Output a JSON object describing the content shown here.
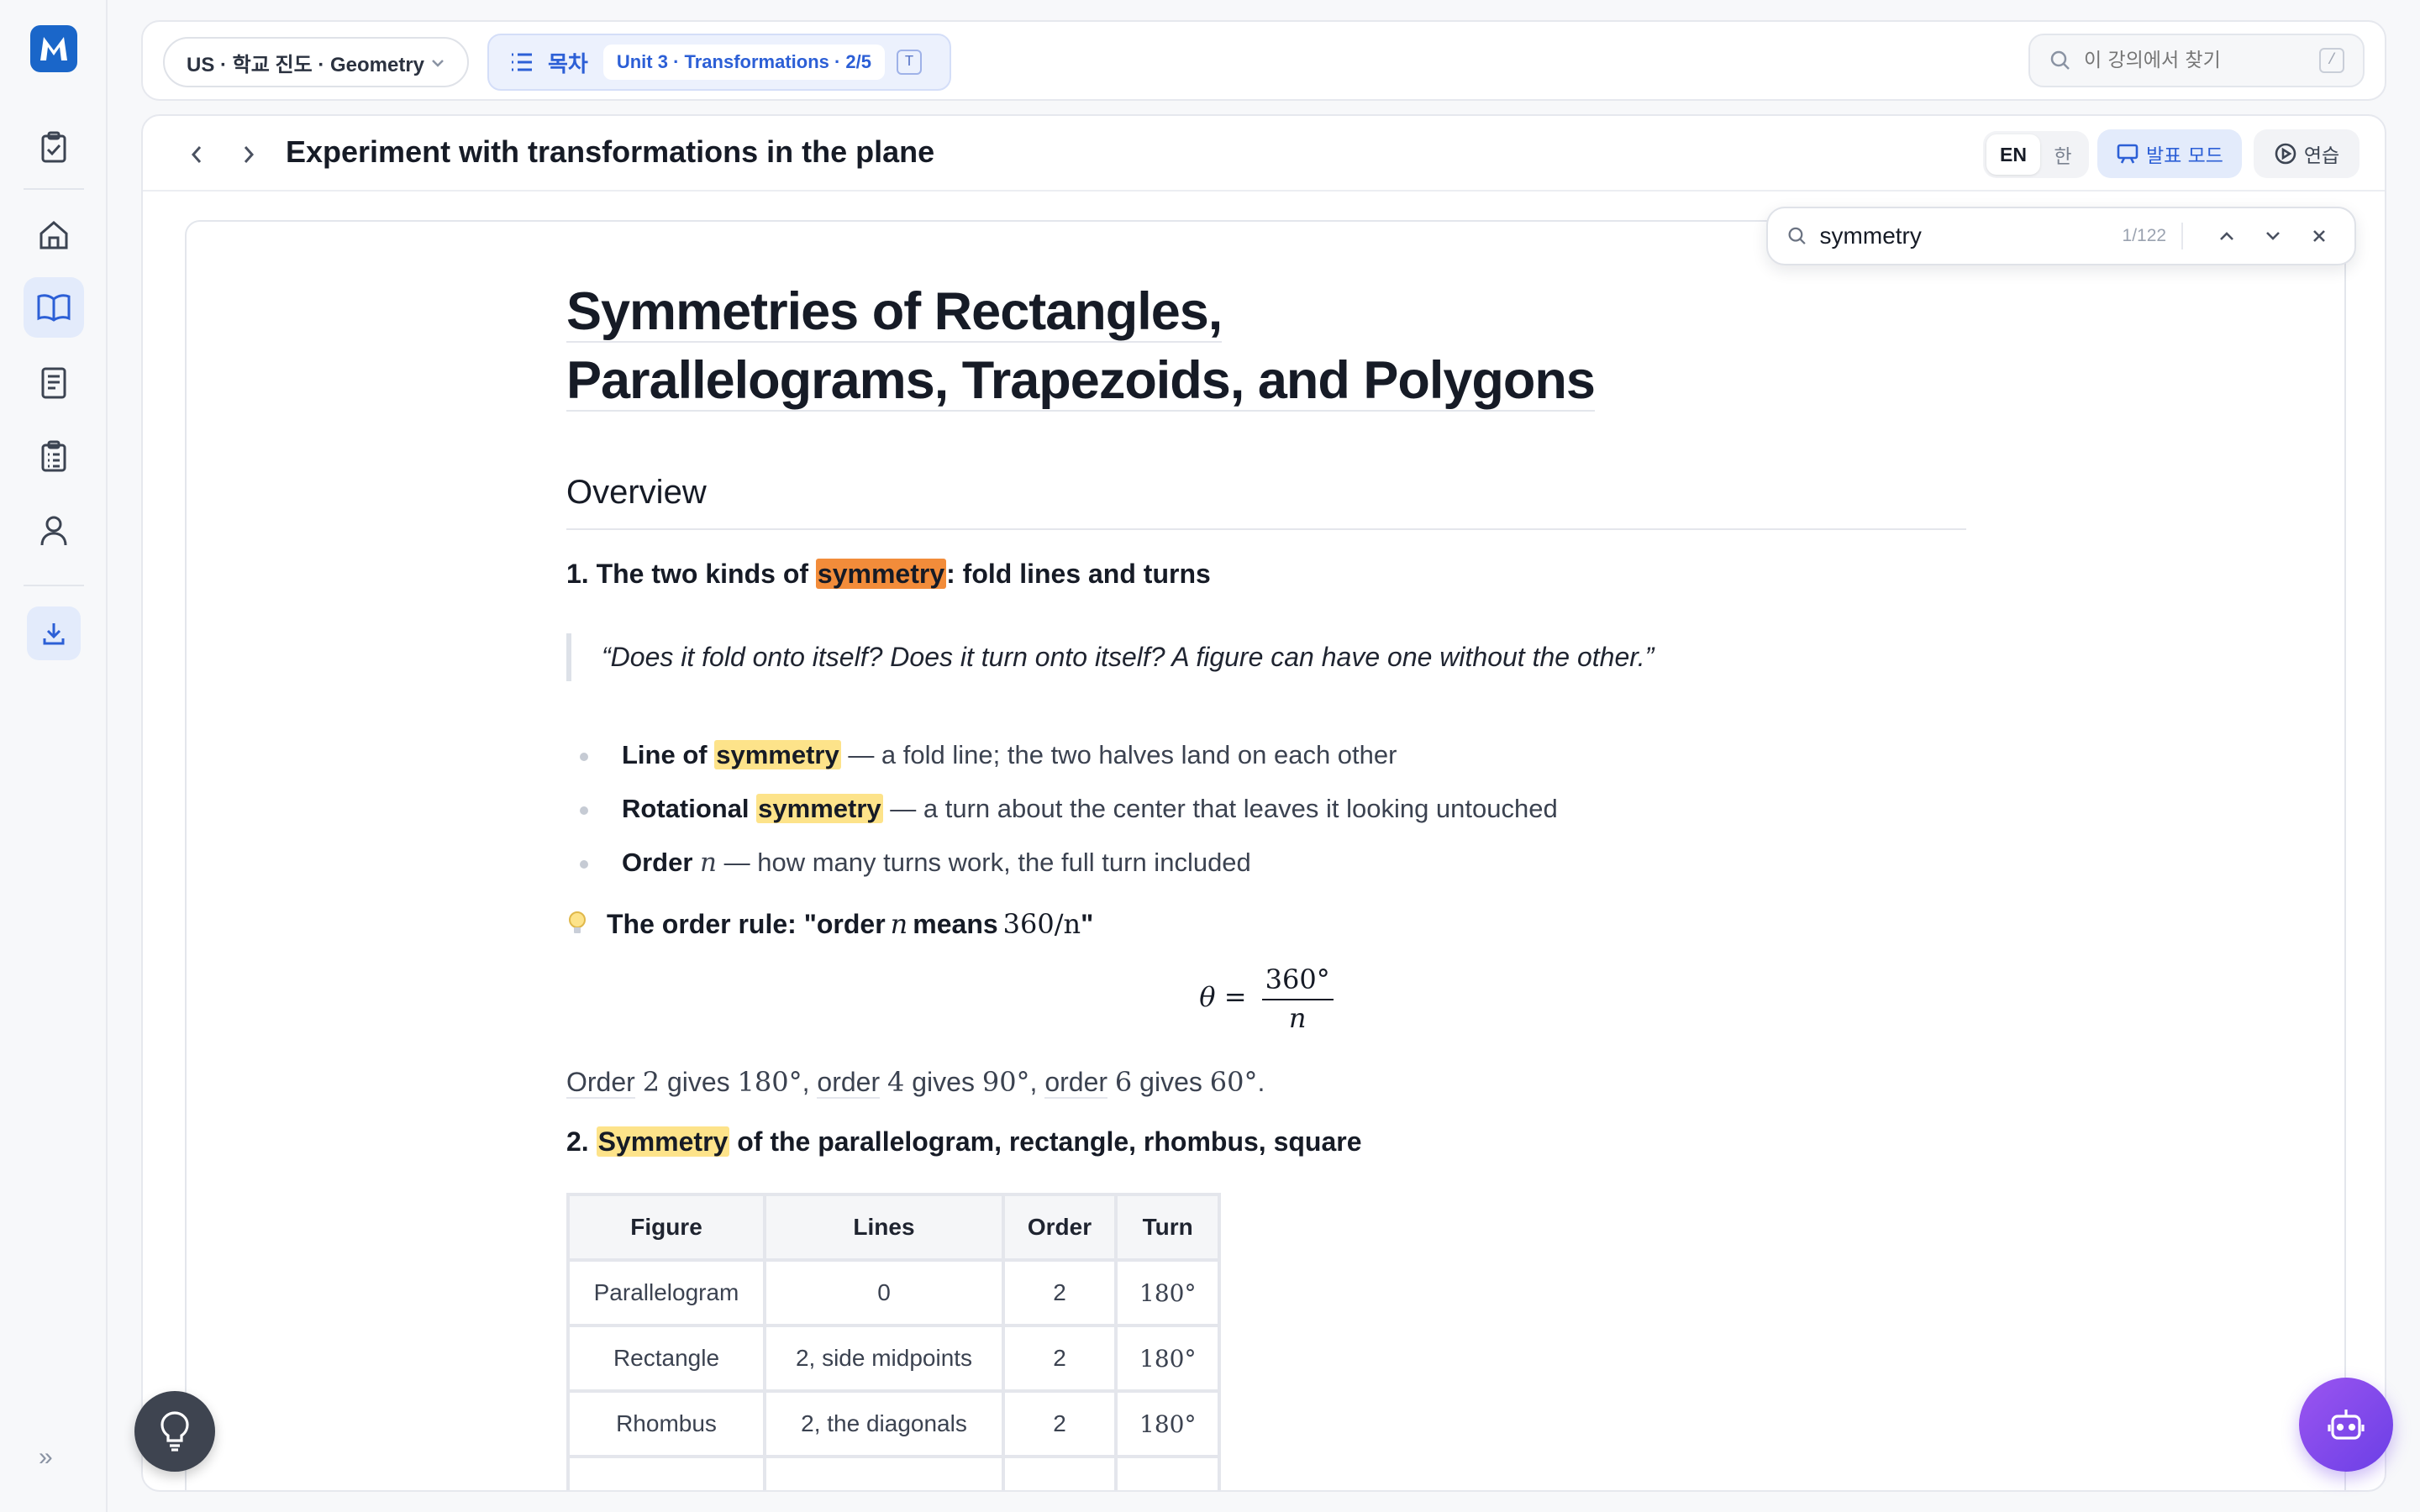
{
  "app": {
    "logo_letter": "M",
    "accent": "#2c5fd6",
    "brand": "#1a66c9"
  },
  "rail": {
    "items": [
      {
        "name": "assignments",
        "icon": "clipboard-check-icon"
      },
      {
        "name": "home",
        "icon": "home-icon"
      },
      {
        "name": "lessons",
        "icon": "book-open-icon",
        "active": true
      },
      {
        "name": "notes",
        "icon": "notebook-icon"
      },
      {
        "name": "tests",
        "icon": "checklist-icon"
      },
      {
        "name": "profile",
        "icon": "user-icon"
      }
    ],
    "download_icon": "download-icon",
    "expand_label": "»"
  },
  "topbar": {
    "course": "US · 학교 진도 · Geometry",
    "toc_label": "목차",
    "toc_unit": "Unit 3 · Transformations · 2/5",
    "toc_shortcut": "T",
    "search_placeholder": "이 강의에서 찾기",
    "search_shortcut": "/"
  },
  "lesson": {
    "title": "Experiment with transformations in the plane",
    "lang_en": "EN",
    "lang_ko": "한",
    "present_label": "발표 모드",
    "practice_label": "연습"
  },
  "find": {
    "query": "symmetry",
    "count": "1/122"
  },
  "doc": {
    "title_line1": "Symmetries of Rectangles,",
    "title_line2": "Parallelograms, Trapezoids, and Polygons",
    "overview": "Overview",
    "sec1_prefix": "1. The two kinds of ",
    "sec1_hl": "symmetry",
    "sec1_suffix": ": fold lines and turns",
    "quote": "“Does it fold onto itself? Does it turn onto itself? A figure can have one without the other.”",
    "terms": [
      {
        "bold": "Line of ",
        "hl": "symmetry",
        "rest": " — a fold line; the two halves land on each other"
      },
      {
        "bold": "Rotational ",
        "hl": "symmetry",
        "rest": " — a turn about the center that leaves it looking untouched"
      },
      {
        "bold": "Order ",
        "var": "n",
        "rest": " — how many turns work, the full turn included"
      }
    ],
    "tip": {
      "a": "The order rule: \"order ",
      "var": "n",
      "b": " means ",
      "expr": "360/n",
      "c": "\""
    },
    "formula": {
      "lhs": "θ =",
      "num": "360°",
      "den": "n"
    },
    "orders": [
      {
        "word": "Order",
        "n": "2",
        "gives": " gives ",
        "deg": "180°",
        "sep": ", "
      },
      {
        "word": "order",
        "n": "4",
        "gives": " gives ",
        "deg": "90°",
        "sep": ", "
      },
      {
        "word": "order",
        "n": "6",
        "gives": " gives ",
        "deg": "60°",
        "sep": "."
      }
    ],
    "sec2_prefix": "2. ",
    "sec2_hl": "Symmetry",
    "sec2_suffix": " of the parallelogram, rectangle, rhombus, square",
    "table": {
      "headers": [
        "Figure",
        "Lines",
        "Order",
        "Turn"
      ],
      "rows": [
        [
          "Parallelogram",
          "0",
          "2",
          "180°"
        ],
        [
          "Rectangle",
          "2, side midpoints",
          "2",
          "180°"
        ],
        [
          "Rhombus",
          "2, the diagonals",
          "2",
          "180°"
        ]
      ]
    }
  },
  "fabs": {
    "hint_icon": "lightbulb-icon",
    "bot_icon": "robot-icon"
  }
}
